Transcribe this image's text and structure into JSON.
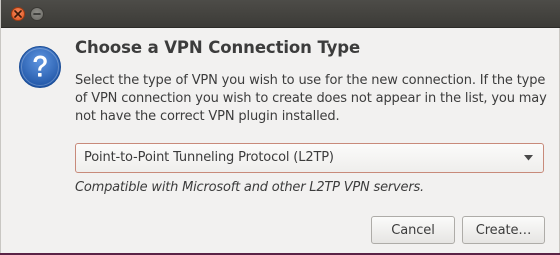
{
  "window": {
    "close_icon": "close-icon",
    "minimize_icon": "minimize-icon"
  },
  "dialog": {
    "icon": "question-icon",
    "title": "Choose a VPN Connection Type",
    "description": "Select the type of VPN you wish to use for the new connection.  If the type of VPN connection you wish to create does not appear in the list, you may not have the correct VPN plugin installed.",
    "vpn_type": {
      "selected": "Point-to-Point Tunneling Protocol (L2TP)"
    },
    "hint": "Compatible with Microsoft and other L2TP VPN servers.",
    "buttons": {
      "cancel": "Cancel",
      "create": "Create…"
    }
  },
  "colors": {
    "titlebar": "#3c3b37",
    "close_button": "#e0541f",
    "dialog_background": "#f2f1f0",
    "select_border": "#c88a7a",
    "question_icon": "#2a63b4"
  }
}
